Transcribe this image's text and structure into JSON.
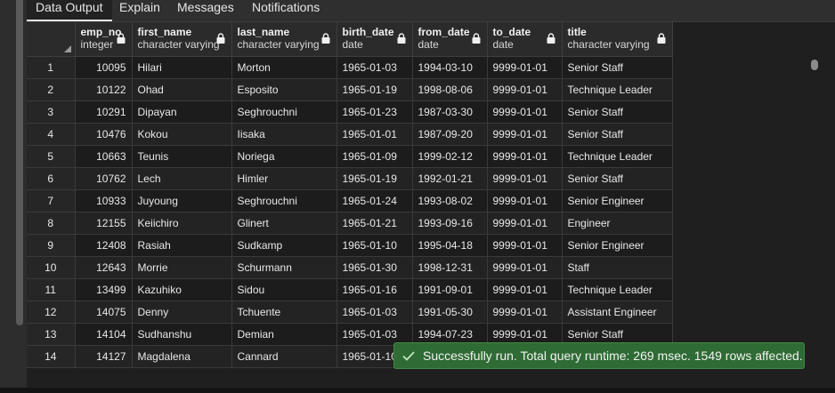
{
  "tabs": [
    {
      "label": "Data Output",
      "active": true
    },
    {
      "label": "Explain",
      "active": false
    },
    {
      "label": "Messages",
      "active": false
    },
    {
      "label": "Notifications",
      "active": false
    }
  ],
  "columns": [
    {
      "name": "emp_no",
      "type": "integer"
    },
    {
      "name": "first_name",
      "type": "character varying"
    },
    {
      "name": "last_name",
      "type": "character varying"
    },
    {
      "name": "birth_date",
      "type": "date"
    },
    {
      "name": "from_date",
      "type": "date"
    },
    {
      "name": "to_date",
      "type": "date"
    },
    {
      "name": "title",
      "type": "character varying"
    }
  ],
  "rows": [
    [
      "1",
      "10095",
      "Hilari",
      "Morton",
      "1965-01-03",
      "1994-03-10",
      "9999-01-01",
      "Senior Staff"
    ],
    [
      "2",
      "10122",
      "Ohad",
      "Esposito",
      "1965-01-19",
      "1998-08-06",
      "9999-01-01",
      "Technique Leader"
    ],
    [
      "3",
      "10291",
      "Dipayan",
      "Seghrouchni",
      "1965-01-23",
      "1987-03-30",
      "9999-01-01",
      "Senior Staff"
    ],
    [
      "4",
      "10476",
      "Kokou",
      "Iisaka",
      "1965-01-01",
      "1987-09-20",
      "9999-01-01",
      "Senior Staff"
    ],
    [
      "5",
      "10663",
      "Teunis",
      "Noriega",
      "1965-01-09",
      "1999-02-12",
      "9999-01-01",
      "Technique Leader"
    ],
    [
      "6",
      "10762",
      "Lech",
      "Himler",
      "1965-01-19",
      "1992-01-21",
      "9999-01-01",
      "Senior Staff"
    ],
    [
      "7",
      "10933",
      "Juyoung",
      "Seghrouchni",
      "1965-01-24",
      "1993-08-02",
      "9999-01-01",
      "Senior Engineer"
    ],
    [
      "8",
      "12155",
      "Keiichiro",
      "Glinert",
      "1965-01-21",
      "1993-09-16",
      "9999-01-01",
      "Engineer"
    ],
    [
      "9",
      "12408",
      "Rasiah",
      "Sudkamp",
      "1965-01-10",
      "1995-04-18",
      "9999-01-01",
      "Senior Engineer"
    ],
    [
      "10",
      "12643",
      "Morrie",
      "Schurmann",
      "1965-01-30",
      "1998-12-31",
      "9999-01-01",
      "Staff"
    ],
    [
      "11",
      "13499",
      "Kazuhiko",
      "Sidou",
      "1965-01-16",
      "1991-09-01",
      "9999-01-01",
      "Technique Leader"
    ],
    [
      "12",
      "14075",
      "Denny",
      "Tchuente",
      "1965-01-03",
      "1991-05-30",
      "9999-01-01",
      "Assistant Engineer"
    ],
    [
      "13",
      "14104",
      "Sudhanshu",
      "Demian",
      "1965-01-03",
      "1994-07-23",
      "9999-01-01",
      "Senior Staff"
    ],
    [
      "14",
      "14127",
      "Magdalena",
      "Cannard",
      "1965-01-10",
      "",
      "",
      ""
    ]
  ],
  "toast": {
    "message": "Successfully run. Total query runtime: 269 msec. 1549 rows affected."
  },
  "colors": {
    "toast_bg": "#2f6b34",
    "header_bg": "#2b2b2b",
    "grid_bg": "#1f1f1f"
  }
}
